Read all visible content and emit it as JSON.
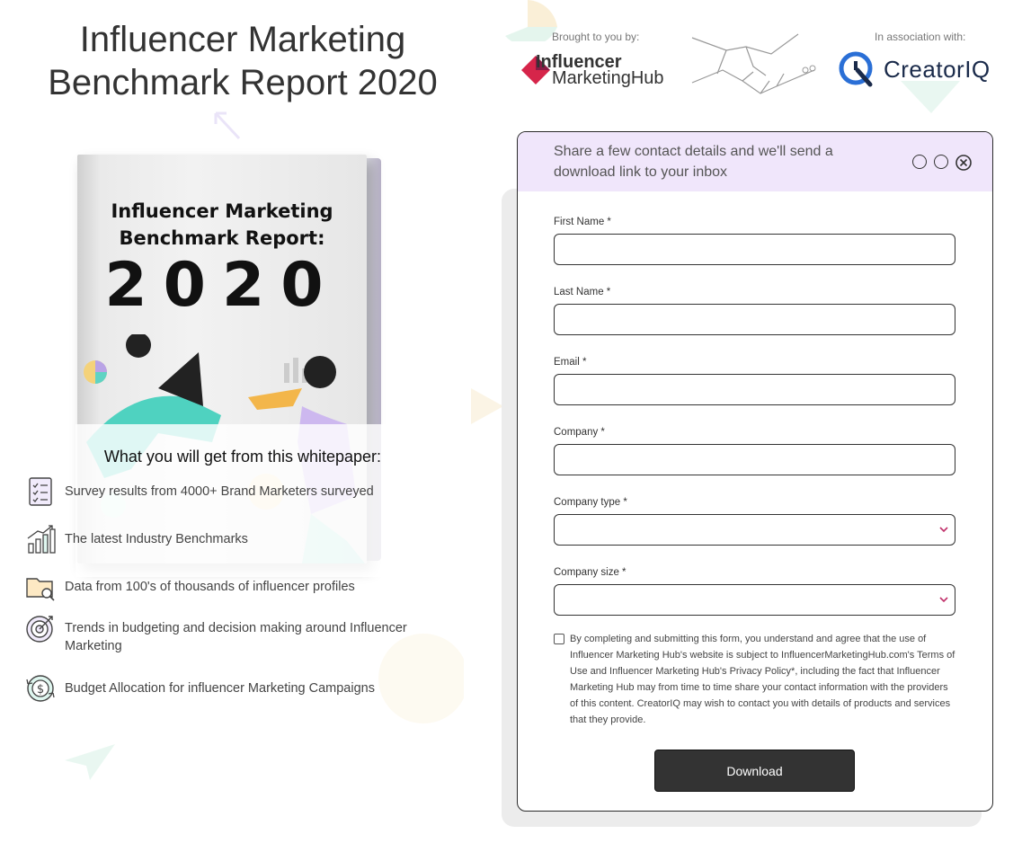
{
  "page": {
    "title_line1": "Influencer Marketing",
    "title_line2": "Benchmark Report 2020"
  },
  "book": {
    "cover_title_line1": "Influencer Marketing",
    "cover_title_line2": "Benchmark Report:",
    "cover_year": "2020"
  },
  "sponsors": {
    "brought_label": "Brought to you by:",
    "brought_logo_line1": "Influencer",
    "brought_logo_line2": "MarketingHub",
    "assoc_label": "In association with:",
    "assoc_logo": "CreatorIQ"
  },
  "benefits": {
    "heading": "What you will get from this whitepaper:",
    "items": [
      {
        "icon": "survey-checklist-icon",
        "text": "Survey results from 4000+ Brand Marketers surveyed"
      },
      {
        "icon": "bar-chart-growth-icon",
        "text": "The latest Industry Benchmarks"
      },
      {
        "icon": "folder-search-icon",
        "text": "Data from 100's of thousands of influencer profiles"
      },
      {
        "icon": "target-icon",
        "text": "Trends in budgeting and decision making around Influencer Marketing"
      },
      {
        "icon": "dollar-cycle-icon",
        "text": "Budget Allocation for influencer Marketing Campaigns"
      }
    ]
  },
  "form": {
    "header": "Share a few contact details and we'll send a download link to your inbox",
    "fields": {
      "first_name": {
        "label": "First Name *",
        "value": ""
      },
      "last_name": {
        "label": "Last Name *",
        "value": ""
      },
      "email": {
        "label": "Email *",
        "value": ""
      },
      "company": {
        "label": "Company *",
        "value": ""
      },
      "company_type": {
        "label": "Company type *",
        "value": ""
      },
      "company_size": {
        "label": "Company size *",
        "value": ""
      }
    },
    "consent_checked": false,
    "consent_text": "By completing and submitting this form, you understand and agree that the use of Influencer Marketing Hub's website is subject to InfluencerMarketingHub.com's Terms of Use and Influencer Marketing Hub's Privacy Policy*, including the fact that Influencer Marketing Hub may from time to time share your contact information with the providers of this content. CreatorIQ may wish to contact you with details of products and services that they provide.",
    "submit_label": "Download"
  },
  "colors": {
    "form_header_bg": "#f0e6fb",
    "button_bg": "#333333",
    "imh_red": "#d6254a",
    "ciq_blue": "#2a6fd6",
    "select_chevron": "#c0306a"
  }
}
